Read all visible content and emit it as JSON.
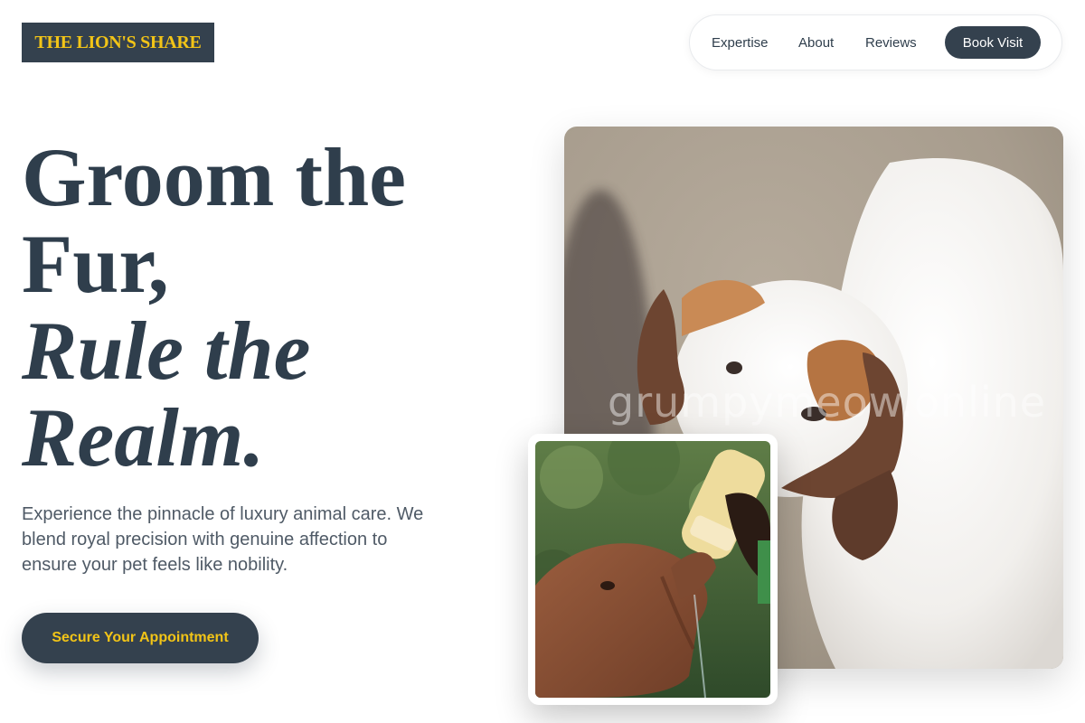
{
  "brand": {
    "logo_text": "THE LION'S SHARE"
  },
  "nav": {
    "links": [
      "Expertise",
      "About",
      "Reviews"
    ],
    "book_label": "Book Visit"
  },
  "hero": {
    "headline_line1": "Groom the",
    "headline_line2": "Fur,",
    "headline_line3": "Rule the",
    "headline_line4": "Realm.",
    "subtitle": "Experience the pinnacle of luxury animal care. We blend royal precision with genuine affection to ensure your pet feels like nobility.",
    "cta_label": "Secure Your Appointment"
  },
  "images": {
    "main_watermark": "grumpymeow.online",
    "main_icon": "puppy-photo",
    "inset_icon": "elephant-feeding-photo"
  },
  "colors": {
    "navy": "#34414e",
    "gold": "#f2c417",
    "text": "#2f3e4c",
    "muted": "#4f5a66"
  }
}
